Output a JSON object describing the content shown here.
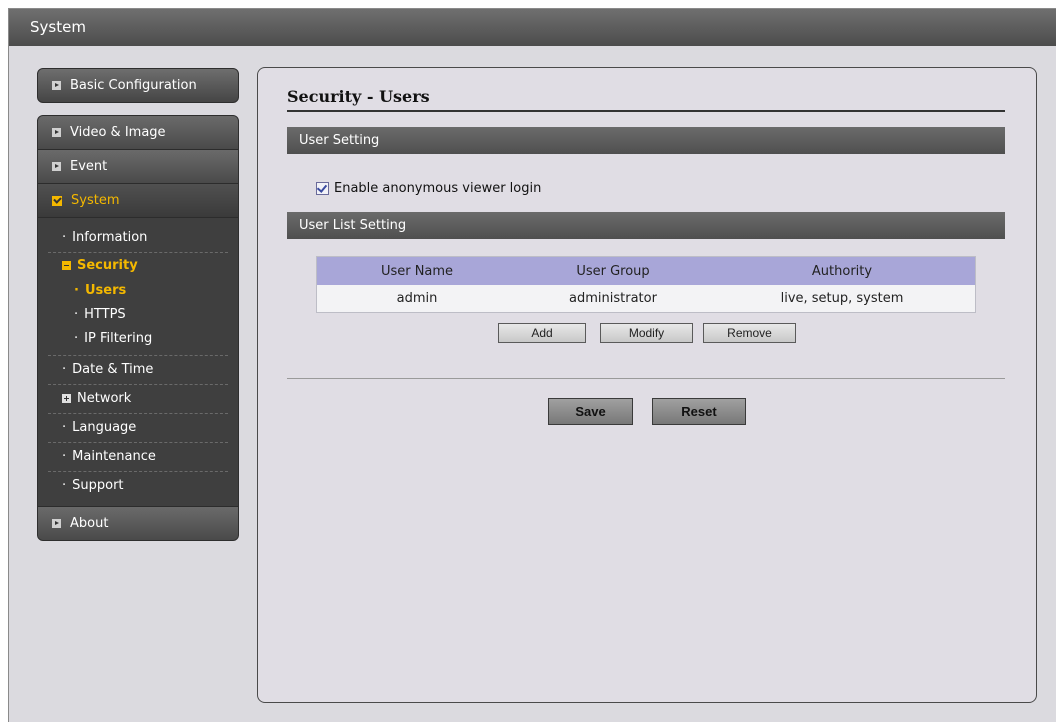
{
  "topbar": {
    "title": "System"
  },
  "sidebar": {
    "basic_configuration": "Basic Configuration",
    "video_image": "Video & Image",
    "event": "Event",
    "system": "System",
    "system_items": {
      "information": "Information",
      "security": "Security",
      "security_children": {
        "users": "Users",
        "https": "HTTPS",
        "ip_filtering": "IP Filtering"
      },
      "date_time": "Date & Time",
      "network": "Network",
      "language": "Language",
      "maintenance": "Maintenance",
      "support": "Support"
    },
    "about": "About"
  },
  "main": {
    "title": "Security - Users",
    "user_setting": {
      "heading": "User Setting",
      "anonymous_label": "Enable anonymous viewer login",
      "anonymous_checked": true
    },
    "user_list": {
      "heading": "User List Setting",
      "columns": [
        "User Name",
        "User Group",
        "Authority"
      ],
      "rows": [
        [
          "admin",
          "administrator",
          "live, setup, system"
        ]
      ],
      "add_label": "Add",
      "modify_label": "Modify",
      "remove_label": "Remove"
    },
    "save_label": "Save",
    "reset_label": "Reset"
  },
  "colors": {
    "accent": "#f4b800",
    "table_header": "#a8a6d8",
    "panel_bg": "#e0dde4"
  }
}
